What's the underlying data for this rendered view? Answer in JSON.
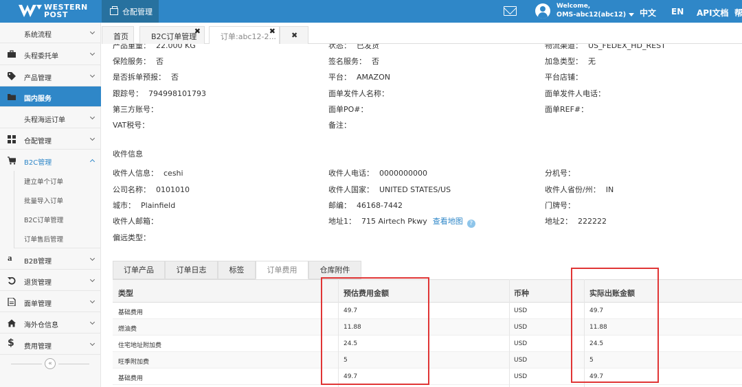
{
  "brand": {
    "line1": "WESTERN",
    "line2": "POST"
  },
  "header": {
    "module_tab": "仓配管理",
    "welcome": "Welcome,",
    "username": "OMS-abc12(abc12)",
    "links": [
      "中文",
      "EN",
      "API文档",
      "帮"
    ]
  },
  "sidebar": {
    "items": [
      {
        "label": "系统流程",
        "icon": "none"
      },
      {
        "label": "头程委托单",
        "icon": "briefcase-icon"
      },
      {
        "label": "产品管理",
        "icon": "tag-icon"
      },
      {
        "label": "国内服务",
        "icon": "folder-icon",
        "active": true
      },
      {
        "label": "头程海运订单",
        "icon": "none"
      },
      {
        "label": "仓配管理",
        "icon": "grid-icon"
      },
      {
        "label": "B2C管理",
        "icon": "cart-icon",
        "open": true
      },
      {
        "label": "B2B管理",
        "icon": "amazon-icon"
      },
      {
        "label": "退货管理",
        "icon": "undo-icon"
      },
      {
        "label": "面单管理",
        "icon": "document-icon"
      },
      {
        "label": "海外仓信息",
        "icon": "home-icon"
      },
      {
        "label": "费用管理",
        "icon": "dollar-icon"
      }
    ],
    "subitems": [
      "建立单个订单",
      "批量导入订单",
      "B2C订单管理",
      "订单售后管理"
    ],
    "collapse": "«"
  },
  "tabs": [
    {
      "label": "首页"
    },
    {
      "label": "B2C订单管理"
    },
    {
      "label": "订单:abc12-2..."
    }
  ],
  "tabs_close_all": "✖",
  "order_fields": {
    "weight": {
      "label": "产品重量：",
      "value": "22.000 KG"
    },
    "status": {
      "label": "状态：",
      "value": "已发货"
    },
    "channel": {
      "label": "物流渠道：",
      "value": "US_FEDEX_HD_REST"
    },
    "insurance": {
      "label": "保险服务：",
      "value": "否"
    },
    "signature": {
      "label": "签名服务：",
      "value": "否"
    },
    "surcharge_type": {
      "label": "加急类型：",
      "value": "无"
    },
    "split": {
      "label": "是否拆单预报：",
      "value": "否"
    },
    "platform": {
      "label": "平台：",
      "value": "AMAZON"
    },
    "store": {
      "label": "平台店铺：",
      "value": ""
    },
    "tracking": {
      "label": "跟踪号：",
      "value": "794998101793"
    },
    "sender_name": {
      "label": "面单发件人名称：",
      "value": ""
    },
    "sender_phone": {
      "label": "面单发件人电话：",
      "value": ""
    },
    "third_party": {
      "label": "第三方账号：",
      "value": ""
    },
    "po": {
      "label": "面单PO#：",
      "value": ""
    },
    "ref": {
      "label": "面单REF#：",
      "value": ""
    },
    "vat": {
      "label": "VAT税号：",
      "value": ""
    },
    "remark": {
      "label": "备注：",
      "value": ""
    }
  },
  "recipient": {
    "section_title": "收件信息",
    "name": {
      "label": "收件人信息：",
      "value": "ceshi"
    },
    "phone": {
      "label": "收件人电话：",
      "value": "0000000000"
    },
    "ext": {
      "label": "分机号：",
      "value": ""
    },
    "company": {
      "label": "公司名称：",
      "value": "0101010"
    },
    "country": {
      "label": "收件人国家：",
      "value": "UNITED STATES/US"
    },
    "state": {
      "label": "收件人省份/州：",
      "value": "IN"
    },
    "city": {
      "label": "城市：",
      "value": "Plainfield"
    },
    "zip": {
      "label": "邮编：",
      "value": "46168-7442"
    },
    "door": {
      "label": "门牌号：",
      "value": ""
    },
    "email": {
      "label": "收件人邮箱：",
      "value": ""
    },
    "address1": {
      "label": "地址1：",
      "value": "715 Airtech Pkwy",
      "map_link": "查看地图",
      "help": "?"
    },
    "address2": {
      "label": "地址2：",
      "value": "222222"
    },
    "remote": {
      "label": "偏远类型：",
      "value": ""
    }
  },
  "content_tabs": [
    "订单产品",
    "订单日志",
    "标签",
    "订单费用",
    "仓库附件"
  ],
  "fee_table": {
    "headers": [
      "类型",
      "预估费用金额",
      "币种",
      "实际出账金额"
    ],
    "rows": [
      [
        "基础费用",
        "49.7",
        "USD",
        "49.7"
      ],
      [
        "燃油费",
        "11.88",
        "USD",
        "11.88"
      ],
      [
        "住宅地址附加费",
        "24.5",
        "USD",
        "24.5"
      ],
      [
        "旺季附加费",
        "5",
        "USD",
        "5"
      ],
      [
        "基础费用",
        "49.7",
        "USD",
        "49.7"
      ]
    ]
  },
  "colors": {
    "primary": "#2f87c8",
    "header_dark": "#27719f",
    "highlight": "#e03434"
  }
}
